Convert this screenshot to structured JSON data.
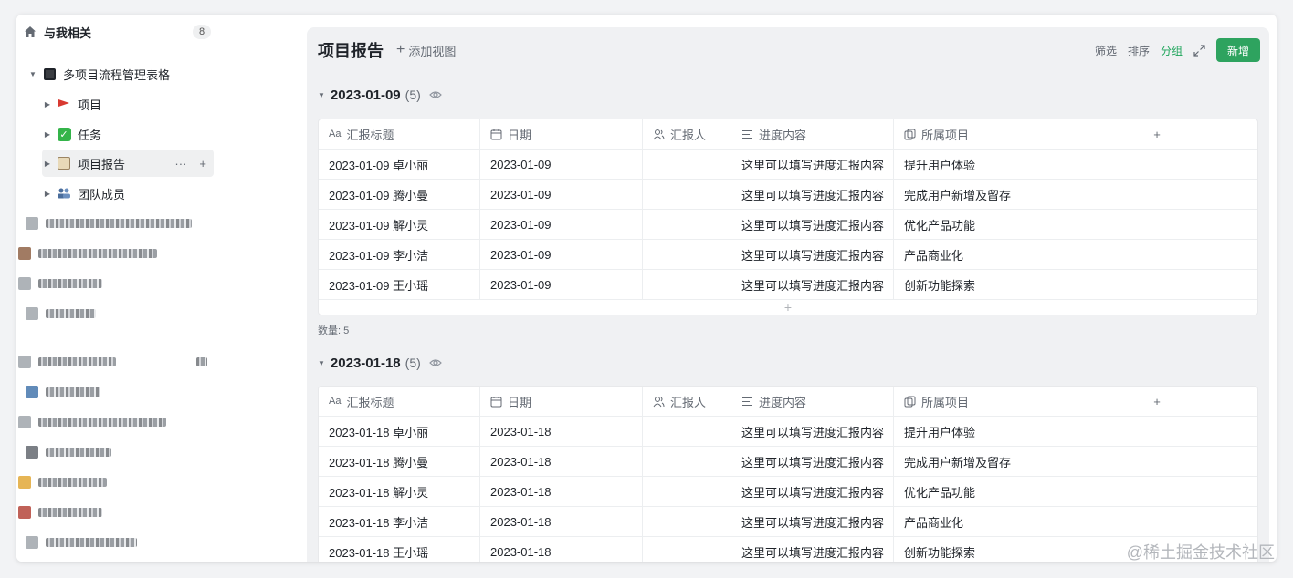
{
  "sidebar": {
    "header_title": "与我相关",
    "header_count": "8",
    "tree": [
      {
        "label": "多项目流程管理表格",
        "icon": "black-square-icon"
      },
      {
        "label": "项目",
        "icon": "red-flag-icon"
      },
      {
        "label": "任务",
        "icon": "check-mark-icon"
      },
      {
        "label": "项目报告",
        "icon": "report-icon"
      },
      {
        "label": "团队成员",
        "icon": "team-icon"
      }
    ],
    "more_label": "···",
    "add_label": "+"
  },
  "main": {
    "title": "项目报告",
    "add_view_label": "添加视图",
    "tools": {
      "filter": "筛选",
      "sort": "排序",
      "group": "分组",
      "new": "新增"
    },
    "columns": [
      "汇报标题",
      "日期",
      "汇报人",
      "进度内容",
      "所属项目"
    ],
    "groups": [
      {
        "title": "2023-01-09",
        "count": "(5)",
        "summary": "数量: 5",
        "rows": [
          [
            "2023-01-09 卓小丽",
            "2023-01-09",
            "",
            "这里可以填写进度汇报内容",
            "提升用户体验"
          ],
          [
            "2023-01-09 腾小曼",
            "2023-01-09",
            "",
            "这里可以填写进度汇报内容",
            "完成用户新增及留存"
          ],
          [
            "2023-01-09 解小灵",
            "2023-01-09",
            "",
            "这里可以填写进度汇报内容",
            "优化产品功能"
          ],
          [
            "2023-01-09 李小洁",
            "2023-01-09",
            "",
            "这里可以填写进度汇报内容",
            "产品商业化"
          ],
          [
            "2023-01-09 王小瑶",
            "2023-01-09",
            "",
            "这里可以填写进度汇报内容",
            "创新功能探索"
          ]
        ]
      },
      {
        "title": "2023-01-18",
        "count": "(5)",
        "rows": [
          [
            "2023-01-18 卓小丽",
            "2023-01-18",
            "",
            "这里可以填写进度汇报内容",
            "提升用户体验"
          ],
          [
            "2023-01-18 腾小曼",
            "2023-01-18",
            "",
            "这里可以填写进度汇报内容",
            "完成用户新增及留存"
          ],
          [
            "2023-01-18 解小灵",
            "2023-01-18",
            "",
            "这里可以填写进度汇报内容",
            "优化产品功能"
          ],
          [
            "2023-01-18 李小洁",
            "2023-01-18",
            "",
            "这里可以填写进度汇报内容",
            "产品商业化"
          ],
          [
            "2023-01-18 王小瑶",
            "2023-01-18",
            "",
            "这里可以填写进度汇报内容",
            "创新功能探索"
          ]
        ]
      }
    ]
  },
  "watermark": "@稀土掘金技术社区",
  "colors": {
    "accent": "#2ea35f",
    "accent_text": "#1fa55b",
    "panel": "#f0f1f3"
  }
}
